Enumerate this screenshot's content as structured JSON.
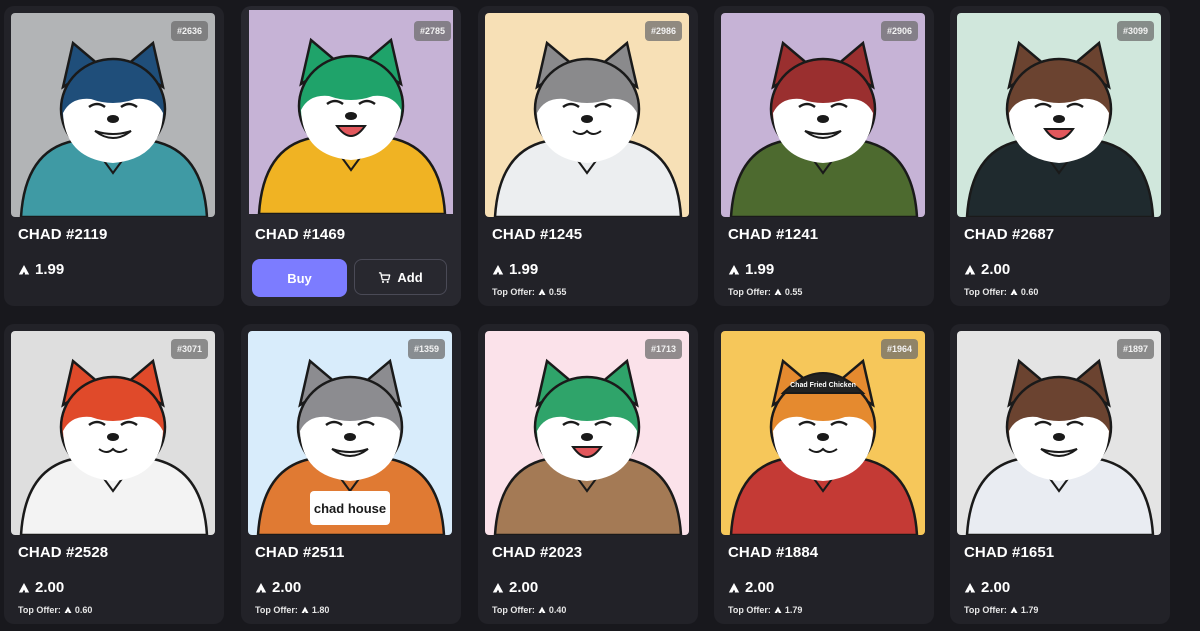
{
  "cards": [
    {
      "badge": "#2636",
      "name": "CHAD #2119",
      "price": "1.99",
      "offer": "",
      "bg": "#b2b4b6",
      "fur": "#1f4e7a",
      "face": "#ffffff",
      "outfit": "#3f9aa4"
    },
    {
      "badge": "#2785",
      "name": "CHAD #1469",
      "price": "",
      "offer": "",
      "bg": "#c6b3d6",
      "fur": "#1fa36a",
      "face": "#ffffff",
      "outfit": "#f0b323",
      "buy_label": "Buy",
      "add_label": "Add"
    },
    {
      "badge": "#2986",
      "name": "CHAD #1245",
      "price": "1.99",
      "offer": "0.55",
      "bg": "#f7e0b6",
      "fur": "#8a8a8c",
      "face": "#ffffff",
      "outfit": "#eceef0"
    },
    {
      "badge": "#2906",
      "name": "CHAD #1241",
      "price": "1.99",
      "offer": "0.55",
      "bg": "#c6b3d6",
      "fur": "#9a2f2f",
      "face": "#ffffff",
      "outfit": "#4d6a2f"
    },
    {
      "badge": "#3099",
      "name": "CHAD #2687",
      "price": "2.00",
      "offer": "0.60",
      "bg": "#d0e7dc",
      "fur": "#6b4330",
      "face": "#ffffff",
      "outfit": "#1f2a2e"
    },
    {
      "badge": "#3071",
      "name": "CHAD #2528",
      "price": "2.00",
      "offer": "0.60",
      "bg": "#dedede",
      "fur": "#e04a2a",
      "face": "#ffffff",
      "outfit": "#f3f3f3"
    },
    {
      "badge": "#1359",
      "name": "CHAD #2511",
      "price": "2.00",
      "offer": "1.80",
      "bg": "#d8ecfb",
      "fur": "#8c8c90",
      "face": "#ffffff",
      "outfit": "#e07a33",
      "shirt_text": "chad house"
    },
    {
      "badge": "#1713",
      "name": "CHAD #2023",
      "price": "2.00",
      "offer": "0.40",
      "bg": "#fbe2ea",
      "fur": "#2fa46a",
      "face": "#ffffff",
      "outfit": "#a47a55"
    },
    {
      "badge": "#1964",
      "name": "CHAD #1884",
      "price": "2.00",
      "offer": "1.79",
      "bg": "#f6c75a",
      "fur": "#e58a2f",
      "face": "#ffffff",
      "outfit": "#c43a35",
      "hat_text": "Chad Fried Chicken"
    },
    {
      "badge": "#1897",
      "name": "CHAD #1651",
      "price": "2.00",
      "offer": "1.79",
      "bg": "#e4e4e4",
      "fur": "#6b4330",
      "face": "#ffffff",
      "outfit": "#e9ecf2"
    }
  ],
  "labels": {
    "top_offer": "Top Offer:"
  },
  "icons": {
    "currency": "avalanche-icon",
    "cart": "cart-icon"
  }
}
